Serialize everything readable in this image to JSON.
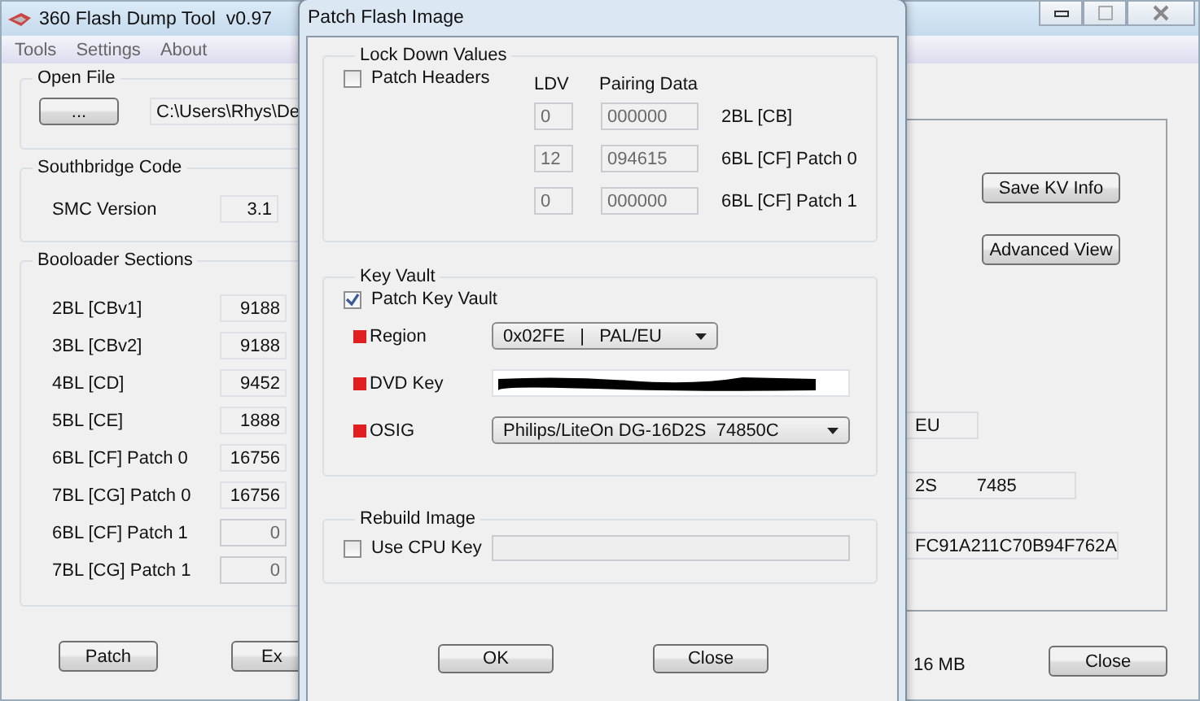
{
  "main_window": {
    "title": "360 Flash Dump Tool  v0.97",
    "menu": [
      "Tools",
      "Settings",
      "About"
    ],
    "open_file": {
      "title": "Open File",
      "button": "...",
      "path": "C:\\Users\\Rhys\\De"
    },
    "southbridge": {
      "title": "Southbridge Code",
      "rows": [
        {
          "label": "SMC Version",
          "value": "3.1",
          "disabled": false
        }
      ]
    },
    "bootloader": {
      "title": "Booloader Sections",
      "rows": [
        {
          "label": "2BL [CBv1]",
          "value": "9188",
          "disabled": false
        },
        {
          "label": "3BL [CBv2]",
          "value": "9188",
          "disabled": false
        },
        {
          "label": "4BL [CD]",
          "value": "9452",
          "disabled": false
        },
        {
          "label": "5BL [CE]",
          "value": "1888",
          "disabled": false
        },
        {
          "label": "6BL [CF] Patch 0",
          "value": "16756",
          "disabled": false
        },
        {
          "label": "7BL [CG] Patch 0",
          "value": "16756",
          "disabled": false
        },
        {
          "label": "6BL [CF] Patch 1",
          "value": "0",
          "disabled": true
        },
        {
          "label": "7BL [CG] Patch 1",
          "value": "0",
          "disabled": true
        }
      ]
    },
    "bottom_buttons": [
      "Patch",
      "Ex"
    ],
    "kv_buttons": [
      "Save KV Info",
      "Advanced View"
    ],
    "kv_fields": [
      "EU",
      "2S        7485",
      "FC91A211C70B94F762A"
    ],
    "size_text": "16 MB",
    "close_button": "Close"
  },
  "dialog": {
    "title": "Patch Flash Image",
    "lock_down": {
      "title": "Lock Down Values",
      "checkbox": {
        "label": "Patch Headers",
        "checked": false
      },
      "columns": [
        "LDV",
        "Pairing Data"
      ],
      "rows": [
        {
          "ldv": "0",
          "pairing": "000000",
          "label": "2BL [CB]"
        },
        {
          "ldv": "12",
          "pairing": "094615",
          "label": "6BL [CF] Patch 0"
        },
        {
          "ldv": "0",
          "pairing": "000000",
          "label": "6BL [CF] Patch 1"
        }
      ]
    },
    "key_vault": {
      "title": "Key Vault",
      "checkbox": {
        "label": "Patch Key Vault",
        "checked": true
      },
      "rows": [
        {
          "kind": "dropdown",
          "label": "Region",
          "value": "0x02FE   |   PAL/EU"
        },
        {
          "kind": "redacted",
          "label": "DVD Key"
        },
        {
          "kind": "dropdown",
          "label": "OSIG",
          "value": "Philips/LiteOn DG-16D2S  74850C"
        }
      ]
    },
    "rebuild": {
      "title": "Rebuild Image",
      "checkbox": {
        "label": "Use CPU Key",
        "checked": false
      }
    },
    "buttons": [
      "OK",
      "Close"
    ]
  }
}
